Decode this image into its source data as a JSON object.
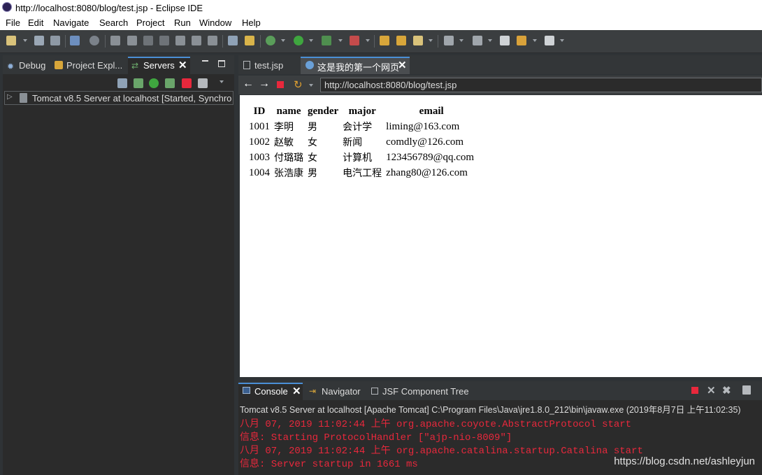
{
  "window": {
    "title": "http://localhost:8080/blog/test.jsp - Eclipse IDE"
  },
  "menu": [
    "File",
    "Edit",
    "Navigate",
    "Search",
    "Project",
    "Run",
    "Window",
    "Help"
  ],
  "left_tabs": {
    "debug": "Debug",
    "project_explorer": "Project Expl...",
    "servers": "Servers"
  },
  "servers": {
    "entry": "Tomcat v8.5 Server at localhost  [Started, Synchro"
  },
  "editor_tabs": {
    "file": "test.jsp",
    "browser": "这是我的第一个网页"
  },
  "browser": {
    "url": "http://localhost:8080/blog/test.jsp"
  },
  "table": {
    "headers": [
      "ID",
      "name",
      "gender",
      "major",
      "email"
    ],
    "rows": [
      [
        "1001",
        "李明",
        "男",
        "会计学",
        "liming@163.com"
      ],
      [
        "1002",
        "赵敏",
        "女",
        "新闻",
        "comdly@126.com"
      ],
      [
        "1003",
        "付璐璐",
        "女",
        "计算机",
        "123456789@qq.com"
      ],
      [
        "1004",
        "张浩康",
        "男",
        "电汽工程",
        "zhang80@126.com"
      ]
    ]
  },
  "console": {
    "tabs": {
      "console": "Console",
      "navigator": "Navigator",
      "jsf": "JSF Component Tree"
    },
    "description": "Tomcat v8.5 Server at localhost [Apache Tomcat] C:\\Program Files\\Java\\jre1.8.0_212\\bin\\javaw.exe (2019年8月7日 上午11:02:35)",
    "lines": [
      "八月 07, 2019 11:02:44 上午 org.apache.coyote.AbstractProtocol start",
      "信息: Starting ProtocolHandler [\"ajp-nio-8009\"]",
      "八月 07, 2019 11:02:44 上午 org.apache.catalina.startup.Catalina start",
      "信息: Server startup in 1661 ms"
    ]
  },
  "watermark": "https://blog.csdn.net/ashleyjun",
  "colors": {
    "accent": "#4a8fd6",
    "console_text": "#e8283c",
    "stop_red": "#e8283c"
  }
}
